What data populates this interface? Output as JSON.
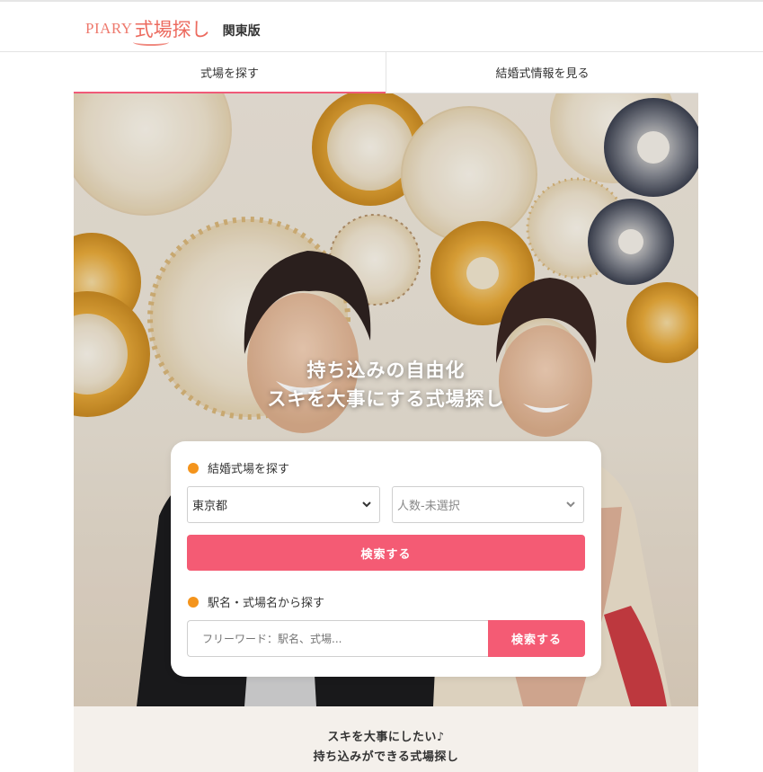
{
  "header": {
    "logo_en": "PIARY",
    "logo_jp": "式場探し",
    "region": "関東版"
  },
  "tabs": [
    {
      "label": "式場を探す",
      "active": true
    },
    {
      "label": "結婚式情報を見る",
      "active": false
    }
  ],
  "hero": {
    "headline_1": "持ち込みの自由化",
    "headline_2": "スキを大事にする式場探し"
  },
  "search_card": {
    "area_title": "結婚式場を探す",
    "prefecture_value": "東京都",
    "guests_value": "人数-未選択",
    "search_button": "検索する",
    "keyword_title": "駅名・式場名から探す",
    "keyword_placeholder": "フリーワード：駅名、式場...",
    "keyword_button": "検索する"
  },
  "footer_section": {
    "line_1": "スキを大事にしたい♪",
    "line_2": "持ち込みができる式場探し"
  },
  "colors": {
    "accent": "#f45b74",
    "dot": "#f4941c",
    "logo": "#ec6a5e"
  },
  "icons": [
    "chevron-down-icon",
    "bullet-dot-icon"
  ]
}
